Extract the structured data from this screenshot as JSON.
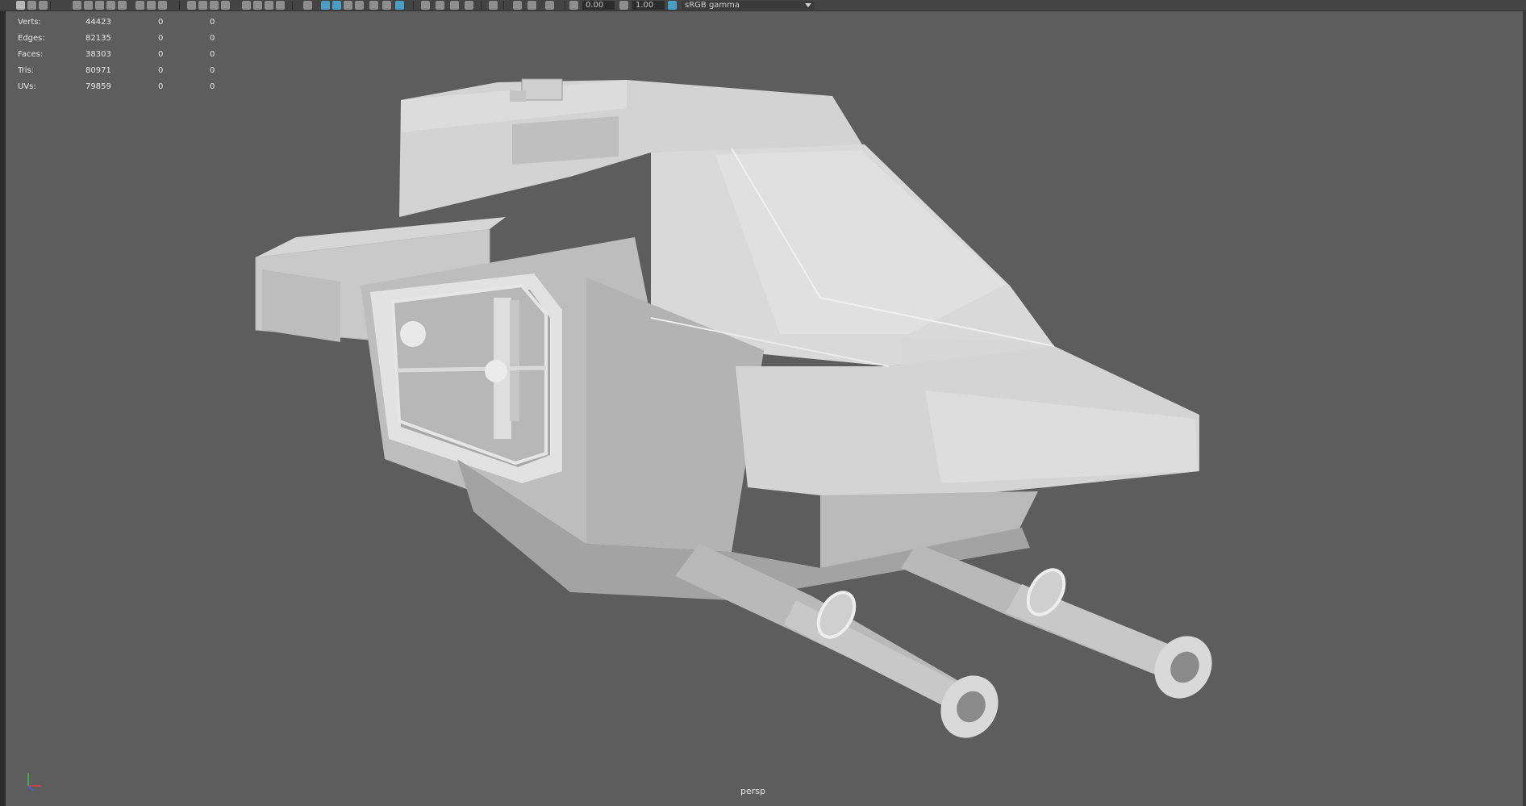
{
  "toolbar": {
    "exposure_value": "0.00",
    "gamma_value": "1.00",
    "color_space": "sRGB gamma"
  },
  "hud": {
    "rows": [
      {
        "label": "Verts:",
        "value": "44423",
        "sel": "0",
        "comp": "0"
      },
      {
        "label": "Edges:",
        "value": "82135",
        "sel": "0",
        "comp": "0"
      },
      {
        "label": "Faces:",
        "value": "38303",
        "sel": "0",
        "comp": "0"
      },
      {
        "label": "Tris:",
        "value": "80971",
        "sel": "0",
        "comp": "0"
      },
      {
        "label": "UVs:",
        "value": "79859",
        "sel": "0",
        "comp": "0"
      }
    ]
  },
  "viewport": {
    "camera_label": "persp",
    "background_color": "#5e5d5e"
  },
  "axis_gizmo": {
    "x_color": "#e04040",
    "y_color": "#40c040",
    "z_color": "#4060ff"
  }
}
